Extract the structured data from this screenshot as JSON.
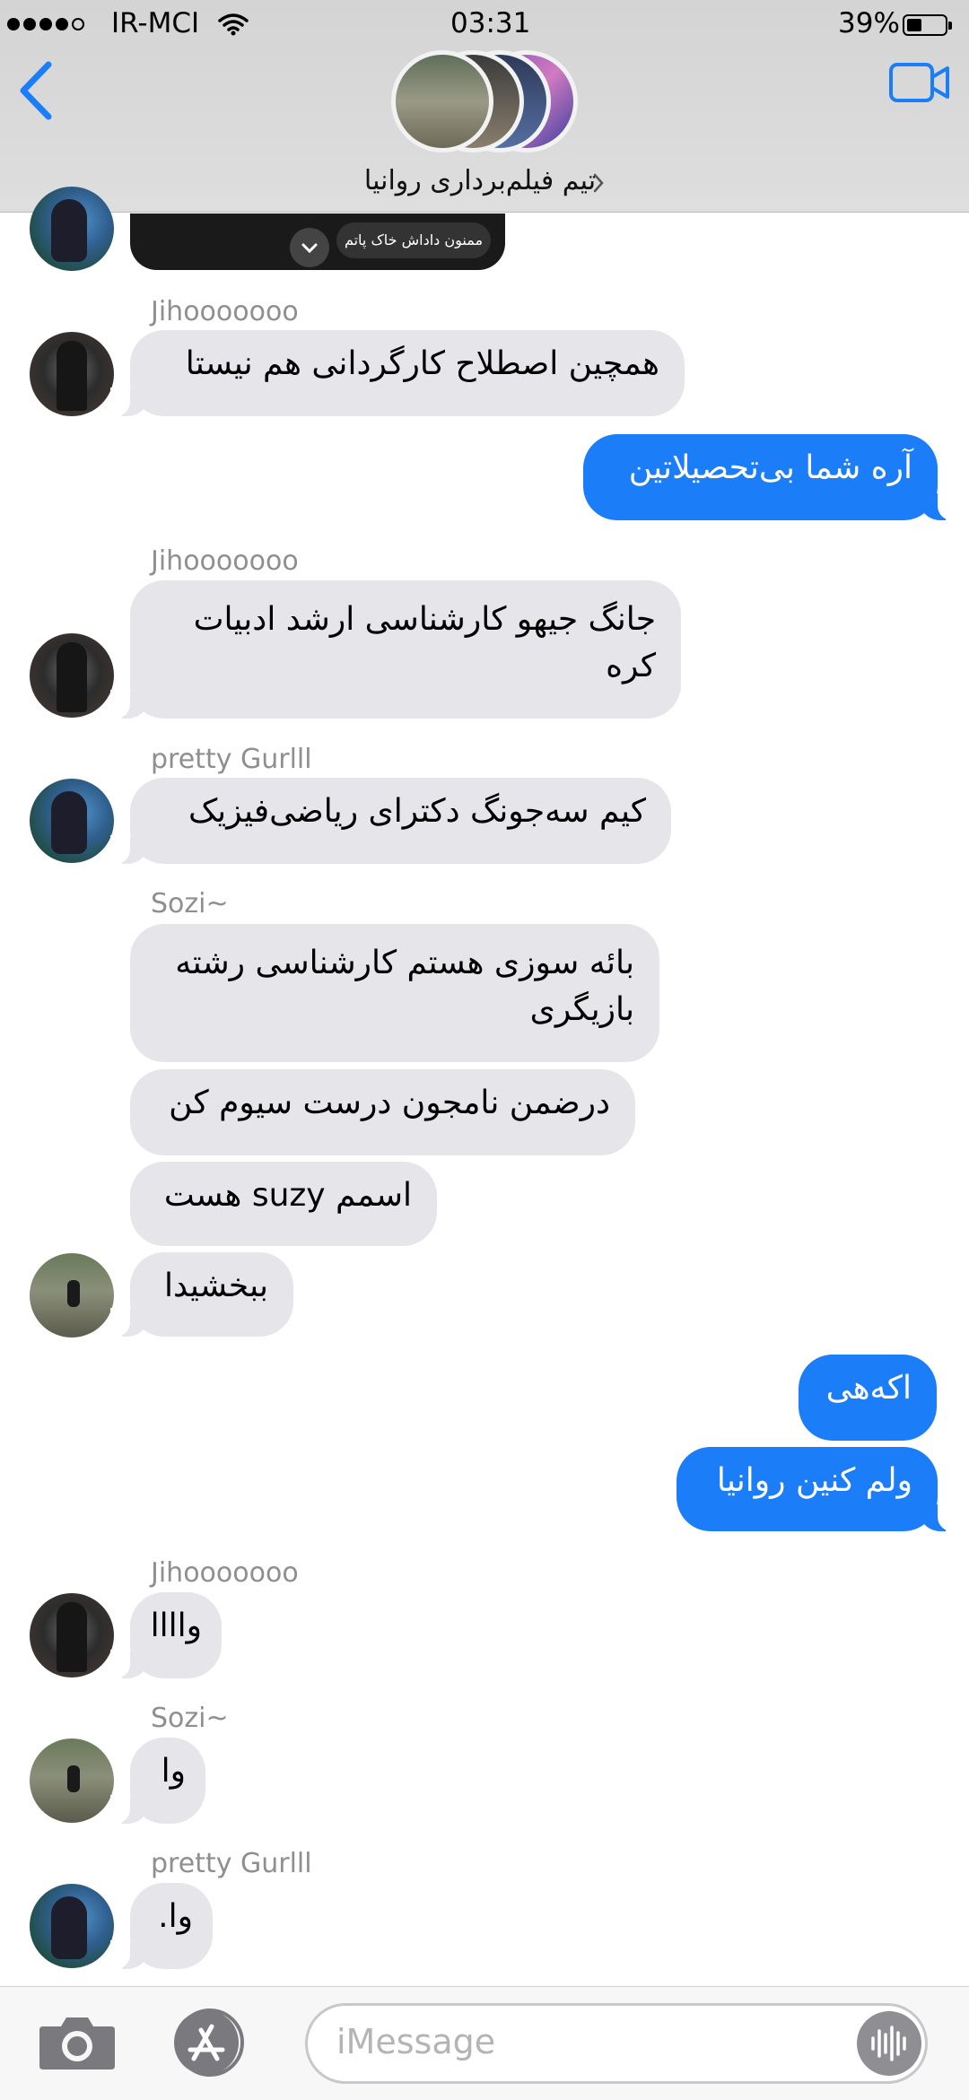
{
  "status_bar": {
    "carrier": "IR-MCI",
    "time": "03:31",
    "battery": "39%",
    "signal_bars": 4
  },
  "header": {
    "group_name": "تیم فیلم‌برداری روانیا",
    "back_icon": "chevron-left-icon",
    "video_icon": "video-camera-icon",
    "accent_color": "#1b7ef8"
  },
  "pinned_preview": {
    "text": "ممنون داداش خاک پاتم"
  },
  "messages": [
    {
      "sender": "Jihooooooo",
      "text": "همچین اصطلاح کارگردانی هم نیستا",
      "from_me": false
    },
    {
      "text": "آره شما بی‌تحصیلاتین",
      "from_me": true
    },
    {
      "sender": "Jihooooooo",
      "text": "جانگ جیهو کارشناسی ارشد ادبیات کره",
      "from_me": false
    },
    {
      "sender": "pretty Gurlll",
      "text": "کیم سه‌جونگ دکترای ریاضی‌فیزیک",
      "from_me": false
    },
    {
      "sender": "Sozi~",
      "text": "بائه سوزی هستم کارشناسی رشته بازیگری",
      "from_me": false
    },
    {
      "text": "درضمن نامجون درست سیوم کن",
      "from_me": false
    },
    {
      "text": "اسمم suzy هست",
      "from_me": false
    },
    {
      "text": "ببخشیدا",
      "from_me": false
    },
    {
      "text": "اکه‌هی",
      "from_me": true
    },
    {
      "text": "ولم کنین روانیا",
      "from_me": true
    },
    {
      "sender": "Jihooooooo",
      "text": "واااا",
      "from_me": false
    },
    {
      "sender": "Sozi~",
      "text": "وا",
      "from_me": false
    },
    {
      "sender": "pretty Gurlll",
      "text": "وا.",
      "from_me": false
    }
  ],
  "composer": {
    "placeholder": "iMessage",
    "camera_icon": "camera-icon",
    "appstore_icon": "app-store-icon",
    "audio_icon": "audio-waveform-icon"
  }
}
